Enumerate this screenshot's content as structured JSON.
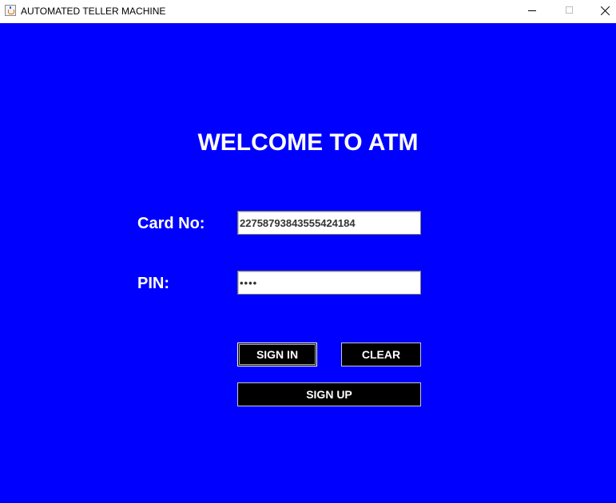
{
  "window": {
    "title": "AUTOMATED TELLER MACHINE",
    "app_icon": "java-cup-icon",
    "controls": [
      "minimize-icon",
      "maximize-icon",
      "close-icon"
    ]
  },
  "colors": {
    "background": "#0000ff",
    "text": "#ffffff",
    "button_bg": "#000000",
    "button_text": "#ffffff"
  },
  "heading": "WELCOME TO ATM",
  "card": {
    "label": "Card No:",
    "value": "2275879384355542418 4"
  },
  "pin": {
    "label": "PIN:",
    "value": "••••"
  },
  "buttons": {
    "sign_in": "SIGN IN",
    "clear": "CLEAR",
    "sign_up": "SIGN UP"
  }
}
